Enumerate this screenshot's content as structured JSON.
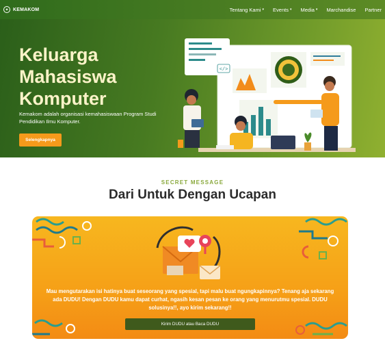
{
  "nav": {
    "logo_icon": "kemakom-logo-icon",
    "logo_text": "KEMAKOM",
    "items": [
      {
        "label": "Tentang Kami",
        "has_dropdown": true
      },
      {
        "label": "Events",
        "has_dropdown": true
      },
      {
        "label": "Media",
        "has_dropdown": true
      },
      {
        "label": "Marchandise",
        "has_dropdown": false
      },
      {
        "label": "Partner",
        "has_dropdown": false
      }
    ],
    "dropdown_icon": "▾"
  },
  "hero": {
    "title_lines": [
      "Keluarga",
      "Mahasiswa",
      "Komputer"
    ],
    "description": "Kemakom adalah organisasi kemahasiswaan Program Studi Pendidikan Ilmu Komputer.",
    "button_label": "Selengkapnya",
    "code_icon_text": "</>"
  },
  "section": {
    "eyebrow": "SECRET MESSAGE",
    "title": "Dari Untuk Dengan Ucapan"
  },
  "card": {
    "text": "Mau mengutarakan isi hatinya buat seseorang yang spesial, tapi malu buat ngungkapinnya? Tenang aja sekarang ada DUDU! Dengan DUDU kamu dapat curhat, ngasih kesan pesan ke orang yang menurutmu spesial. DUDU solusinya!!, ayo kirim sekarang!!",
    "button_label": "Kirim DUDU atau Baca DUDU"
  },
  "colors": {
    "nav_bg": "#3f7420",
    "hero_title": "#fbf3c8",
    "accent_orange": "#f59a1b",
    "eyebrow_green": "#8aa93d",
    "card_button": "#3f5a1c"
  }
}
